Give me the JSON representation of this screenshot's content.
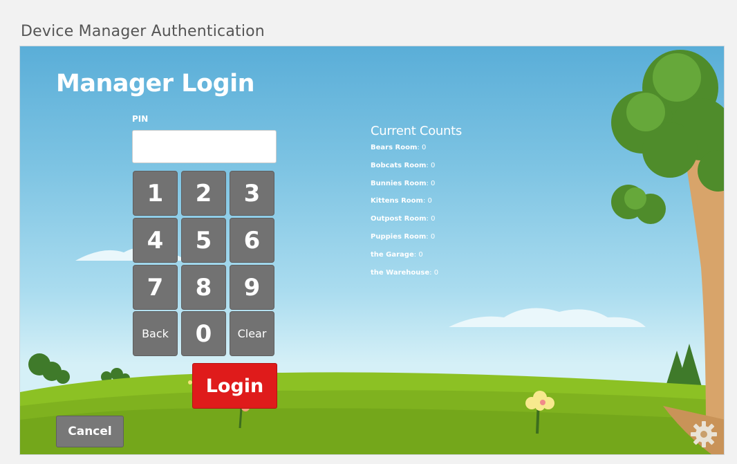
{
  "page": {
    "caption": "Device Manager Authentication"
  },
  "login": {
    "title": "Manager Login",
    "pin_label": "PIN",
    "pin_value": "",
    "keypad": [
      "1",
      "2",
      "3",
      "4",
      "5",
      "6",
      "7",
      "8",
      "9",
      "Back",
      "0",
      "Clear"
    ],
    "login_label": "Login",
    "cancel_label": "Cancel"
  },
  "counts": {
    "title": "Current Counts",
    "rooms": [
      {
        "name": "Bears Room",
        "sep": ": ",
        "count": "0"
      },
      {
        "name": "Bobcats Room",
        "sep": ": ",
        "count": "0"
      },
      {
        "name": "Bunnies Room",
        "sep": ": ",
        "count": "0"
      },
      {
        "name": "Kittens Room",
        "sep": ": ",
        "count": "0"
      },
      {
        "name": "Outpost Room",
        "sep": ": ",
        "count": "0"
      },
      {
        "name": "Puppies Room",
        "sep": ": ",
        "count": "0"
      },
      {
        "name": "the Garage",
        "sep": ": ",
        "count": "0"
      },
      {
        "name": "the Warehouse",
        "sep": ": ",
        "count": "0"
      }
    ]
  },
  "icons": {
    "settings": "gear-icon"
  },
  "colors": {
    "login_button": "#df1b1b",
    "keypad_key": "#727272",
    "cancel_button": "#787878",
    "sky": "#5aaed8",
    "grass": "#7fb21f"
  }
}
